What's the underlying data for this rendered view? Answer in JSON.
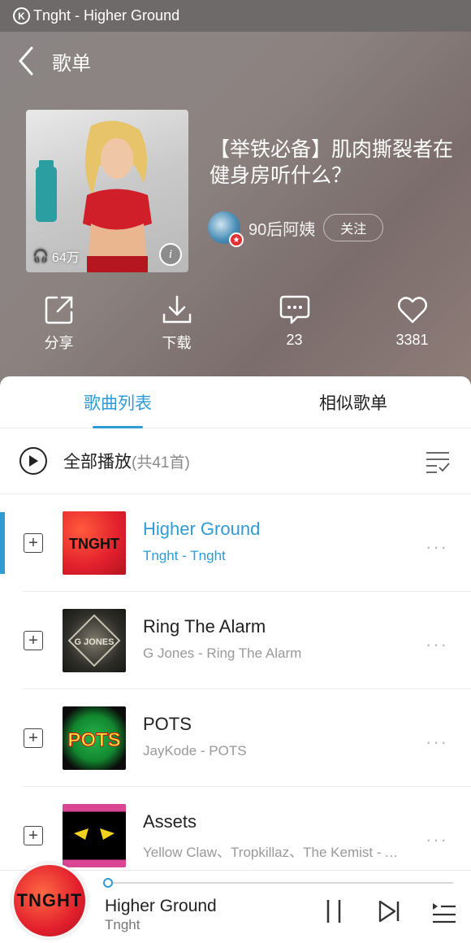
{
  "status_bar": {
    "app_icon": "K",
    "title": "Tnght - Higher Ground"
  },
  "nav": {
    "back_icon": "chevron-left",
    "title": "歌单"
  },
  "playlist": {
    "title": "【举铁必备】肌肉撕裂者在健身房听什么？",
    "play_count": "64万",
    "creator": {
      "name": "90后阿姨",
      "follow_label": "关注"
    }
  },
  "actions": [
    {
      "icon": "share",
      "label": "分享"
    },
    {
      "icon": "download",
      "label": "下载"
    },
    {
      "icon": "comment",
      "label": "23"
    },
    {
      "icon": "heart",
      "label": "3381"
    }
  ],
  "tabs": [
    {
      "label": "歌曲列表",
      "active": true
    },
    {
      "label": "相似歌单",
      "active": false
    }
  ],
  "play_all": {
    "label": "全部播放",
    "count": "(共41首)"
  },
  "songs": [
    {
      "title": "Higher Ground",
      "artist": "Tnght - Tnght",
      "active": true
    },
    {
      "title": "Ring The Alarm",
      "artist": "G Jones - Ring The Alarm",
      "active": false
    },
    {
      "title": "POTS",
      "artist": "JayKode - POTS",
      "active": false
    },
    {
      "title": "Assets",
      "artist": "Yellow Claw、Tropkillaz、The Kemist - Assets",
      "active": false
    }
  ],
  "now_playing": {
    "title": "Higher Ground",
    "artist": "Tnght",
    "progress": 0.0
  },
  "colors": {
    "accent": "#2f9bd6"
  }
}
